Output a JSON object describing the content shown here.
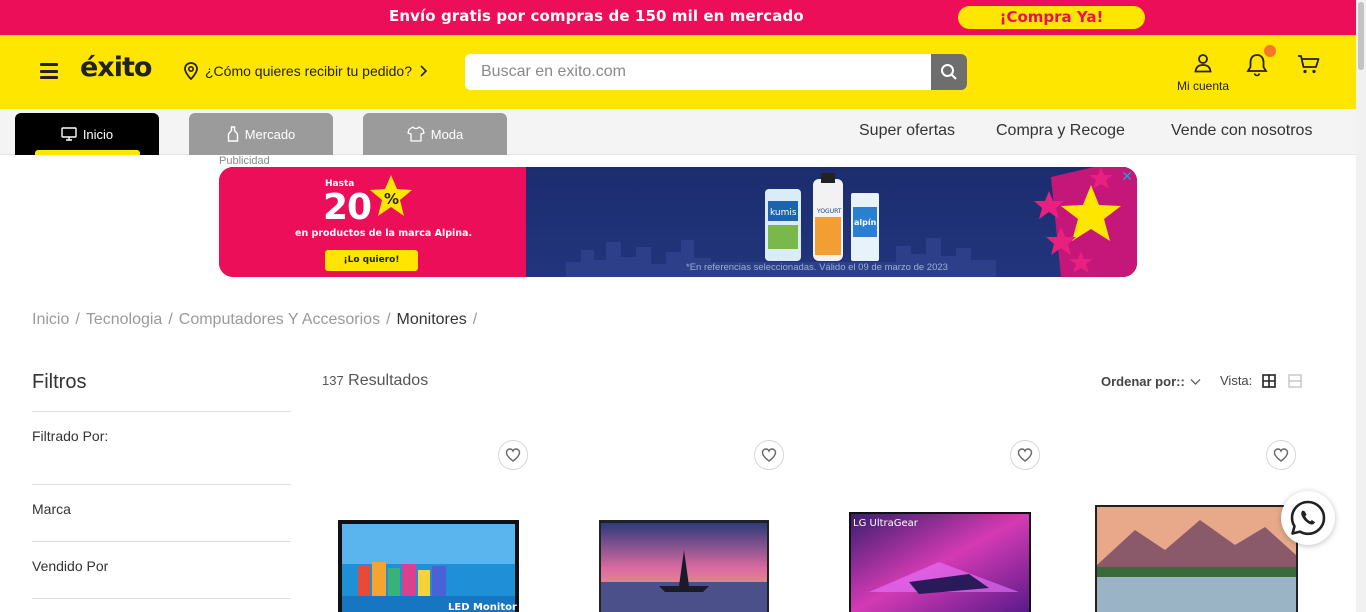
{
  "promo": {
    "text": "Envío gratis por compras de 150 mil en mercado",
    "cta": "¡Compra Ya!"
  },
  "header": {
    "logo": "éxito",
    "delivery_prompt": "¿Cómo quieres recibir tu pedido?",
    "search_placeholder": "Buscar en exito.com",
    "account_label": "Mi cuenta"
  },
  "nav": {
    "tabs": [
      {
        "label": "Inicio",
        "icon": "monitor-icon",
        "active": true
      },
      {
        "label": "Mercado",
        "icon": "bottle-icon",
        "active": false
      },
      {
        "label": "Moda",
        "icon": "shirt-icon",
        "active": false
      }
    ],
    "links": [
      "Super ofertas",
      "Compra y Recoge",
      "Vende con nosotros"
    ]
  },
  "ad": {
    "label": "Publicidad",
    "hasta": "Hasta",
    "percent": "20",
    "percent_sign": "%",
    "subtitle": "en productos de la marca Alpina.",
    "button": "¡Lo quiero!",
    "legal": "*En referencias seleccionadas. Válido el 09 de marzo de 2023",
    "product_labels": [
      "kumis",
      "YOGURT",
      "alpín"
    ]
  },
  "breadcrumb": [
    "Inicio",
    "Tecnologia",
    "Computadores Y Accesorios",
    "Monitores"
  ],
  "filters": {
    "title": "Filtros",
    "filtered_by": "Filtrado Por:",
    "groups": [
      "Marca",
      "Vendido Por"
    ]
  },
  "results": {
    "count": "137",
    "label": "Resultados",
    "order_by": "Ordenar por::",
    "view_label": "Vista:"
  },
  "products": [
    {
      "image_caption": "LED Monitor"
    },
    {
      "image_caption": ""
    },
    {
      "image_caption": "LG UltraGear"
    },
    {
      "image_caption": ""
    }
  ],
  "colors": {
    "brand_yellow": "#ffe600",
    "promo_pink": "#ec0e59",
    "ad_navy": "#1c2a6b"
  }
}
